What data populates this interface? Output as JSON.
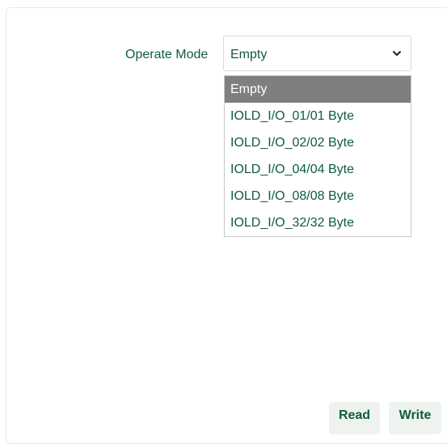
{
  "form": {
    "operate_mode_label": "Operate Mode",
    "operate_mode_value": "Empty"
  },
  "dropdown": {
    "selected_index": 0,
    "options": [
      "Empty",
      "IOLD_I/O_01/01 Byte",
      "IOLD_I/O_02/02 Byte",
      "IOLD_I/O_04/04 Byte",
      "IOLD_I/O_08/08 Byte",
      "IOLD_I/O_32/32 Byte"
    ]
  },
  "actions": {
    "read_label": "Read",
    "write_label": "Write"
  },
  "colors": {
    "text_accent": "#0f5c3a",
    "selected_option_bg": "#7f7f7f",
    "button_bg": "#eef3f0"
  },
  "icons": {
    "dropdown_chevron": "chevron-down-icon"
  }
}
